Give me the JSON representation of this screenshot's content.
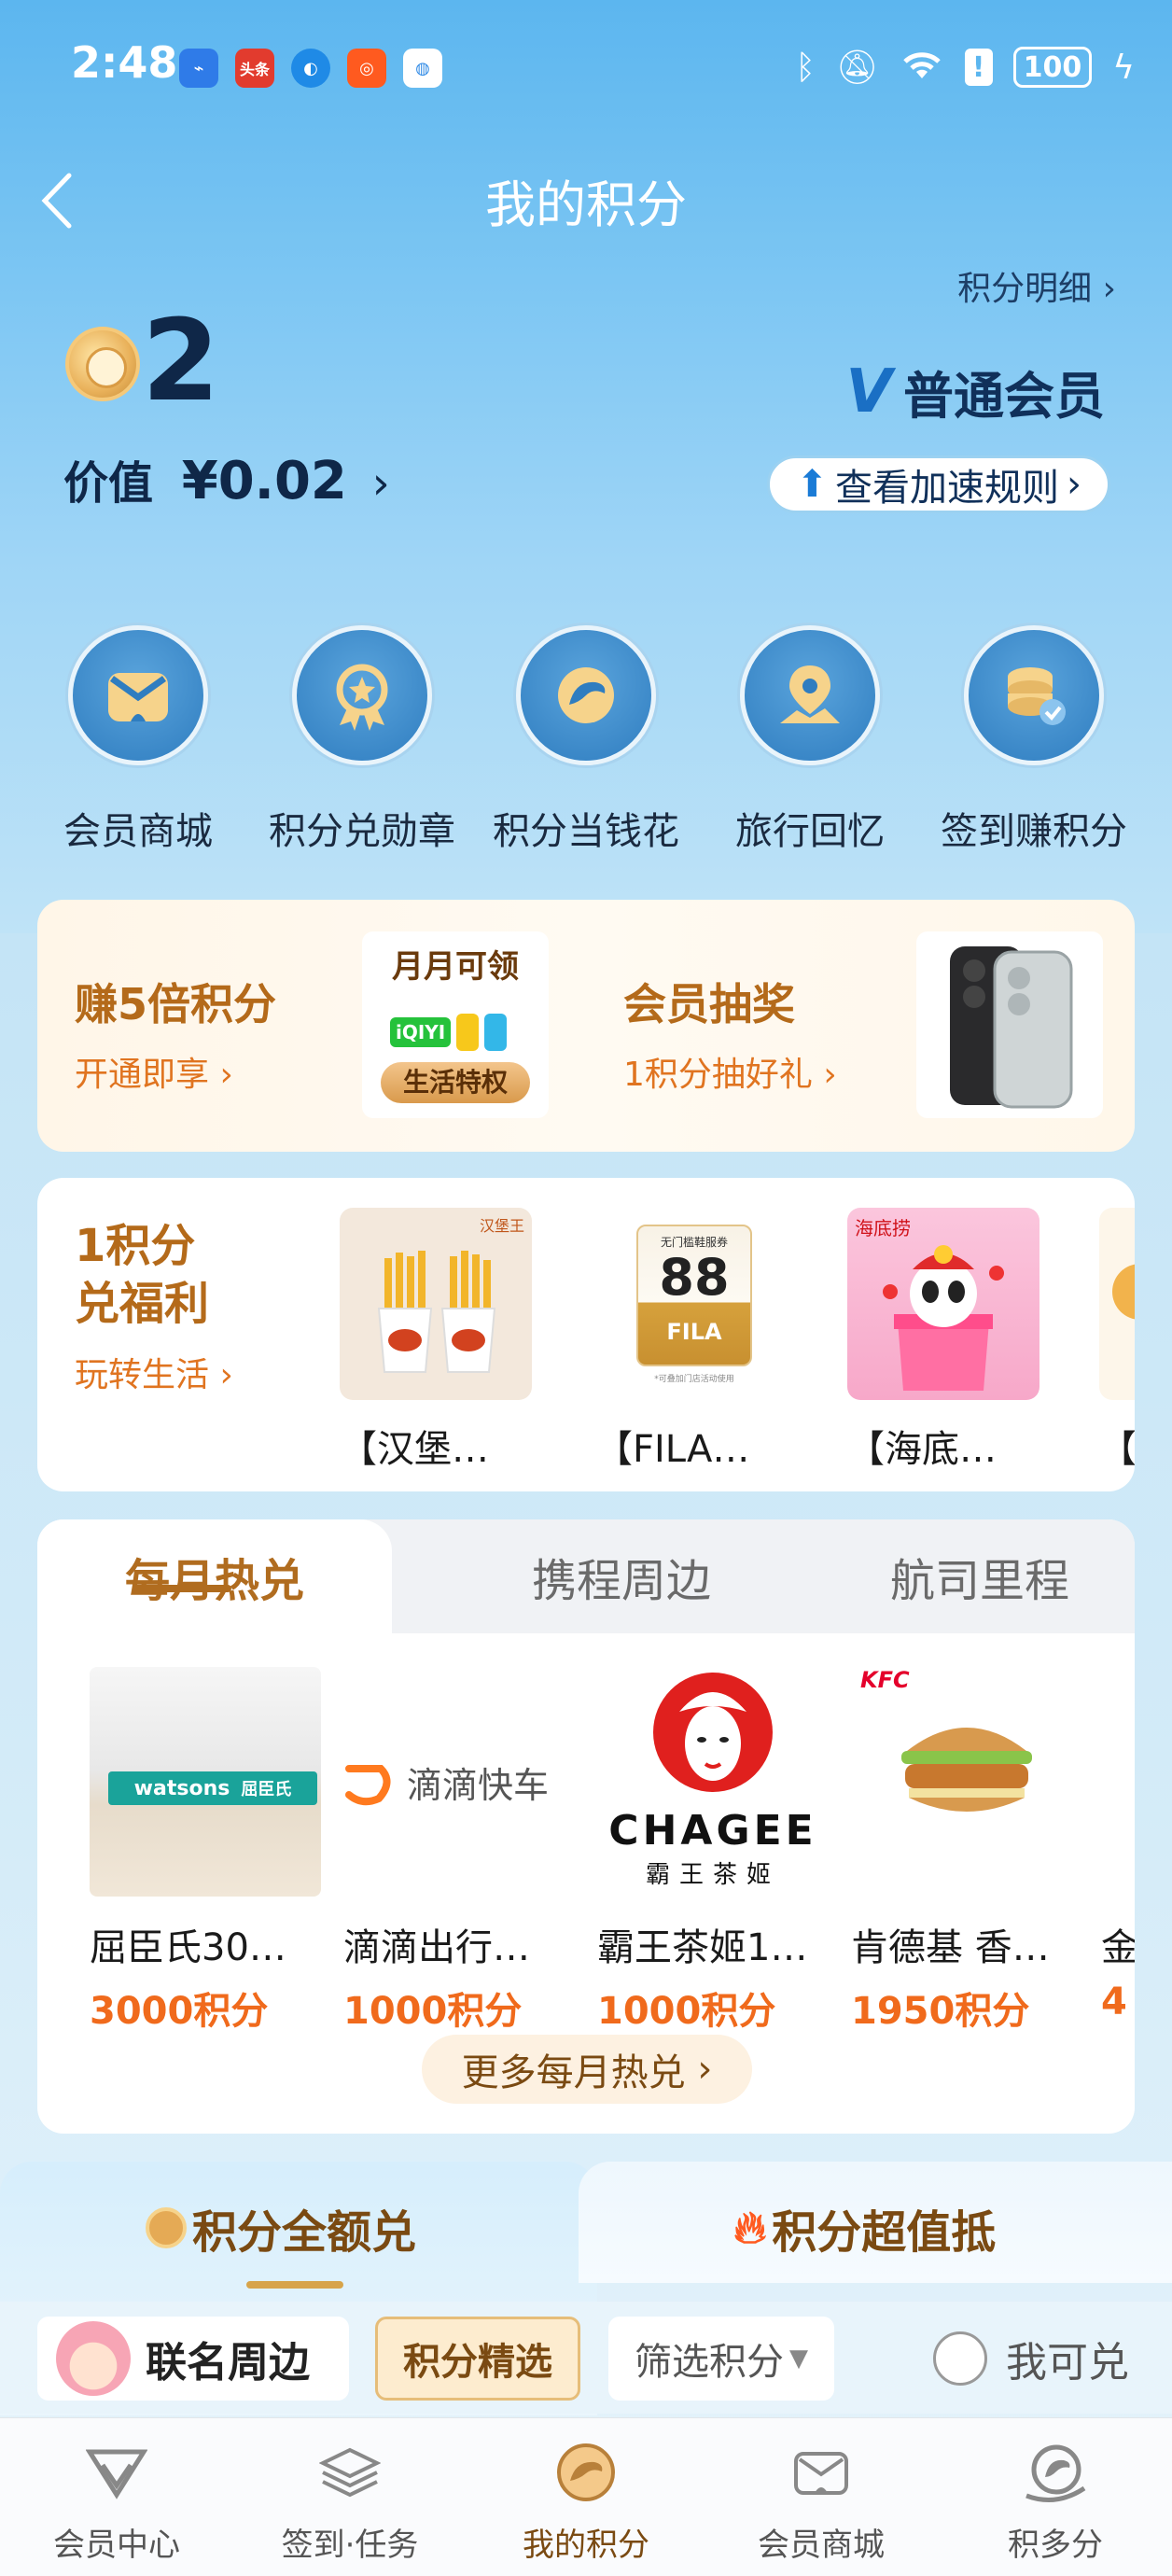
{
  "status_bar": {
    "time": "2:48",
    "battery": "100",
    "apps": [
      "头条"
    ]
  },
  "header": {
    "title": "我的积分",
    "detail_link": "积分明细"
  },
  "points": {
    "balance": "2",
    "value_label": "价值",
    "value": "¥0.02",
    "member_level": "普通会员",
    "speed_rules_label": "查看加速规则"
  },
  "shortcuts": [
    {
      "label": "会员商城",
      "icon": "member-mall-icon"
    },
    {
      "label": "积分兑勋章",
      "icon": "medal-icon"
    },
    {
      "label": "积分当钱花",
      "icon": "coin-icon"
    },
    {
      "label": "旅行回忆",
      "icon": "map-pin-icon"
    },
    {
      "label": "签到赚积分",
      "icon": "coin-stack-icon"
    }
  ],
  "promo": {
    "left_title": "赚5倍积分",
    "left_sub": "开通即享",
    "left_img_top": "月月可领",
    "left_img_bottom": "生活特权",
    "left_img_brand": "iQIYI",
    "right_title": "会员抽奖",
    "right_sub": "1积分抽好礼"
  },
  "welfare": {
    "title_line1": "1积分",
    "title_line2": "兑福利",
    "sub": "玩转生活",
    "items": [
      {
        "name": "【汉堡…",
        "brand": "汉堡王"
      },
      {
        "name": "【FILA…",
        "top": "无门槛鞋服券",
        "amount": "88",
        "brand": "FILA",
        "note": "*可叠加门店活动使用"
      },
      {
        "name": "【海底…",
        "brand": "海底捞"
      },
      {
        "name": "【"
      }
    ]
  },
  "hot_tabs": {
    "tabs": [
      "每月热兑",
      "携程周边",
      "航司里程"
    ],
    "items": [
      {
        "name": "屈臣氏30…",
        "price": "3000积分",
        "brand": "watsons",
        "brand_cn": "屈臣氏"
      },
      {
        "name": "滴滴出行…",
        "price": "1000积分",
        "brand": "滴滴快车"
      },
      {
        "name": "霸王茶姬1…",
        "price": "1000积分",
        "brand": "CHAGEE",
        "brand_cn": "霸王茶姬"
      },
      {
        "name": "肯德基 香…",
        "price": "1950积分",
        "brand": "KFC"
      },
      {
        "name": "金",
        "price": "4"
      }
    ],
    "more_label": "更多每月热兑"
  },
  "segments": {
    "left": "积分全额兑",
    "right": "积分超值抵",
    "chips": [
      "联名周边",
      "积分精选",
      "筛选积分"
    ],
    "toggle_label": "我可兑"
  },
  "bottom_nav": [
    {
      "label": "会员中心"
    },
    {
      "label": "签到·任务"
    },
    {
      "label": "我的积分"
    },
    {
      "label": "会员商城"
    },
    {
      "label": "积多分"
    }
  ],
  "colors": {
    "accent": "#b06c1f",
    "price": "#f06a1c",
    "sky": "#5cb6ef"
  }
}
